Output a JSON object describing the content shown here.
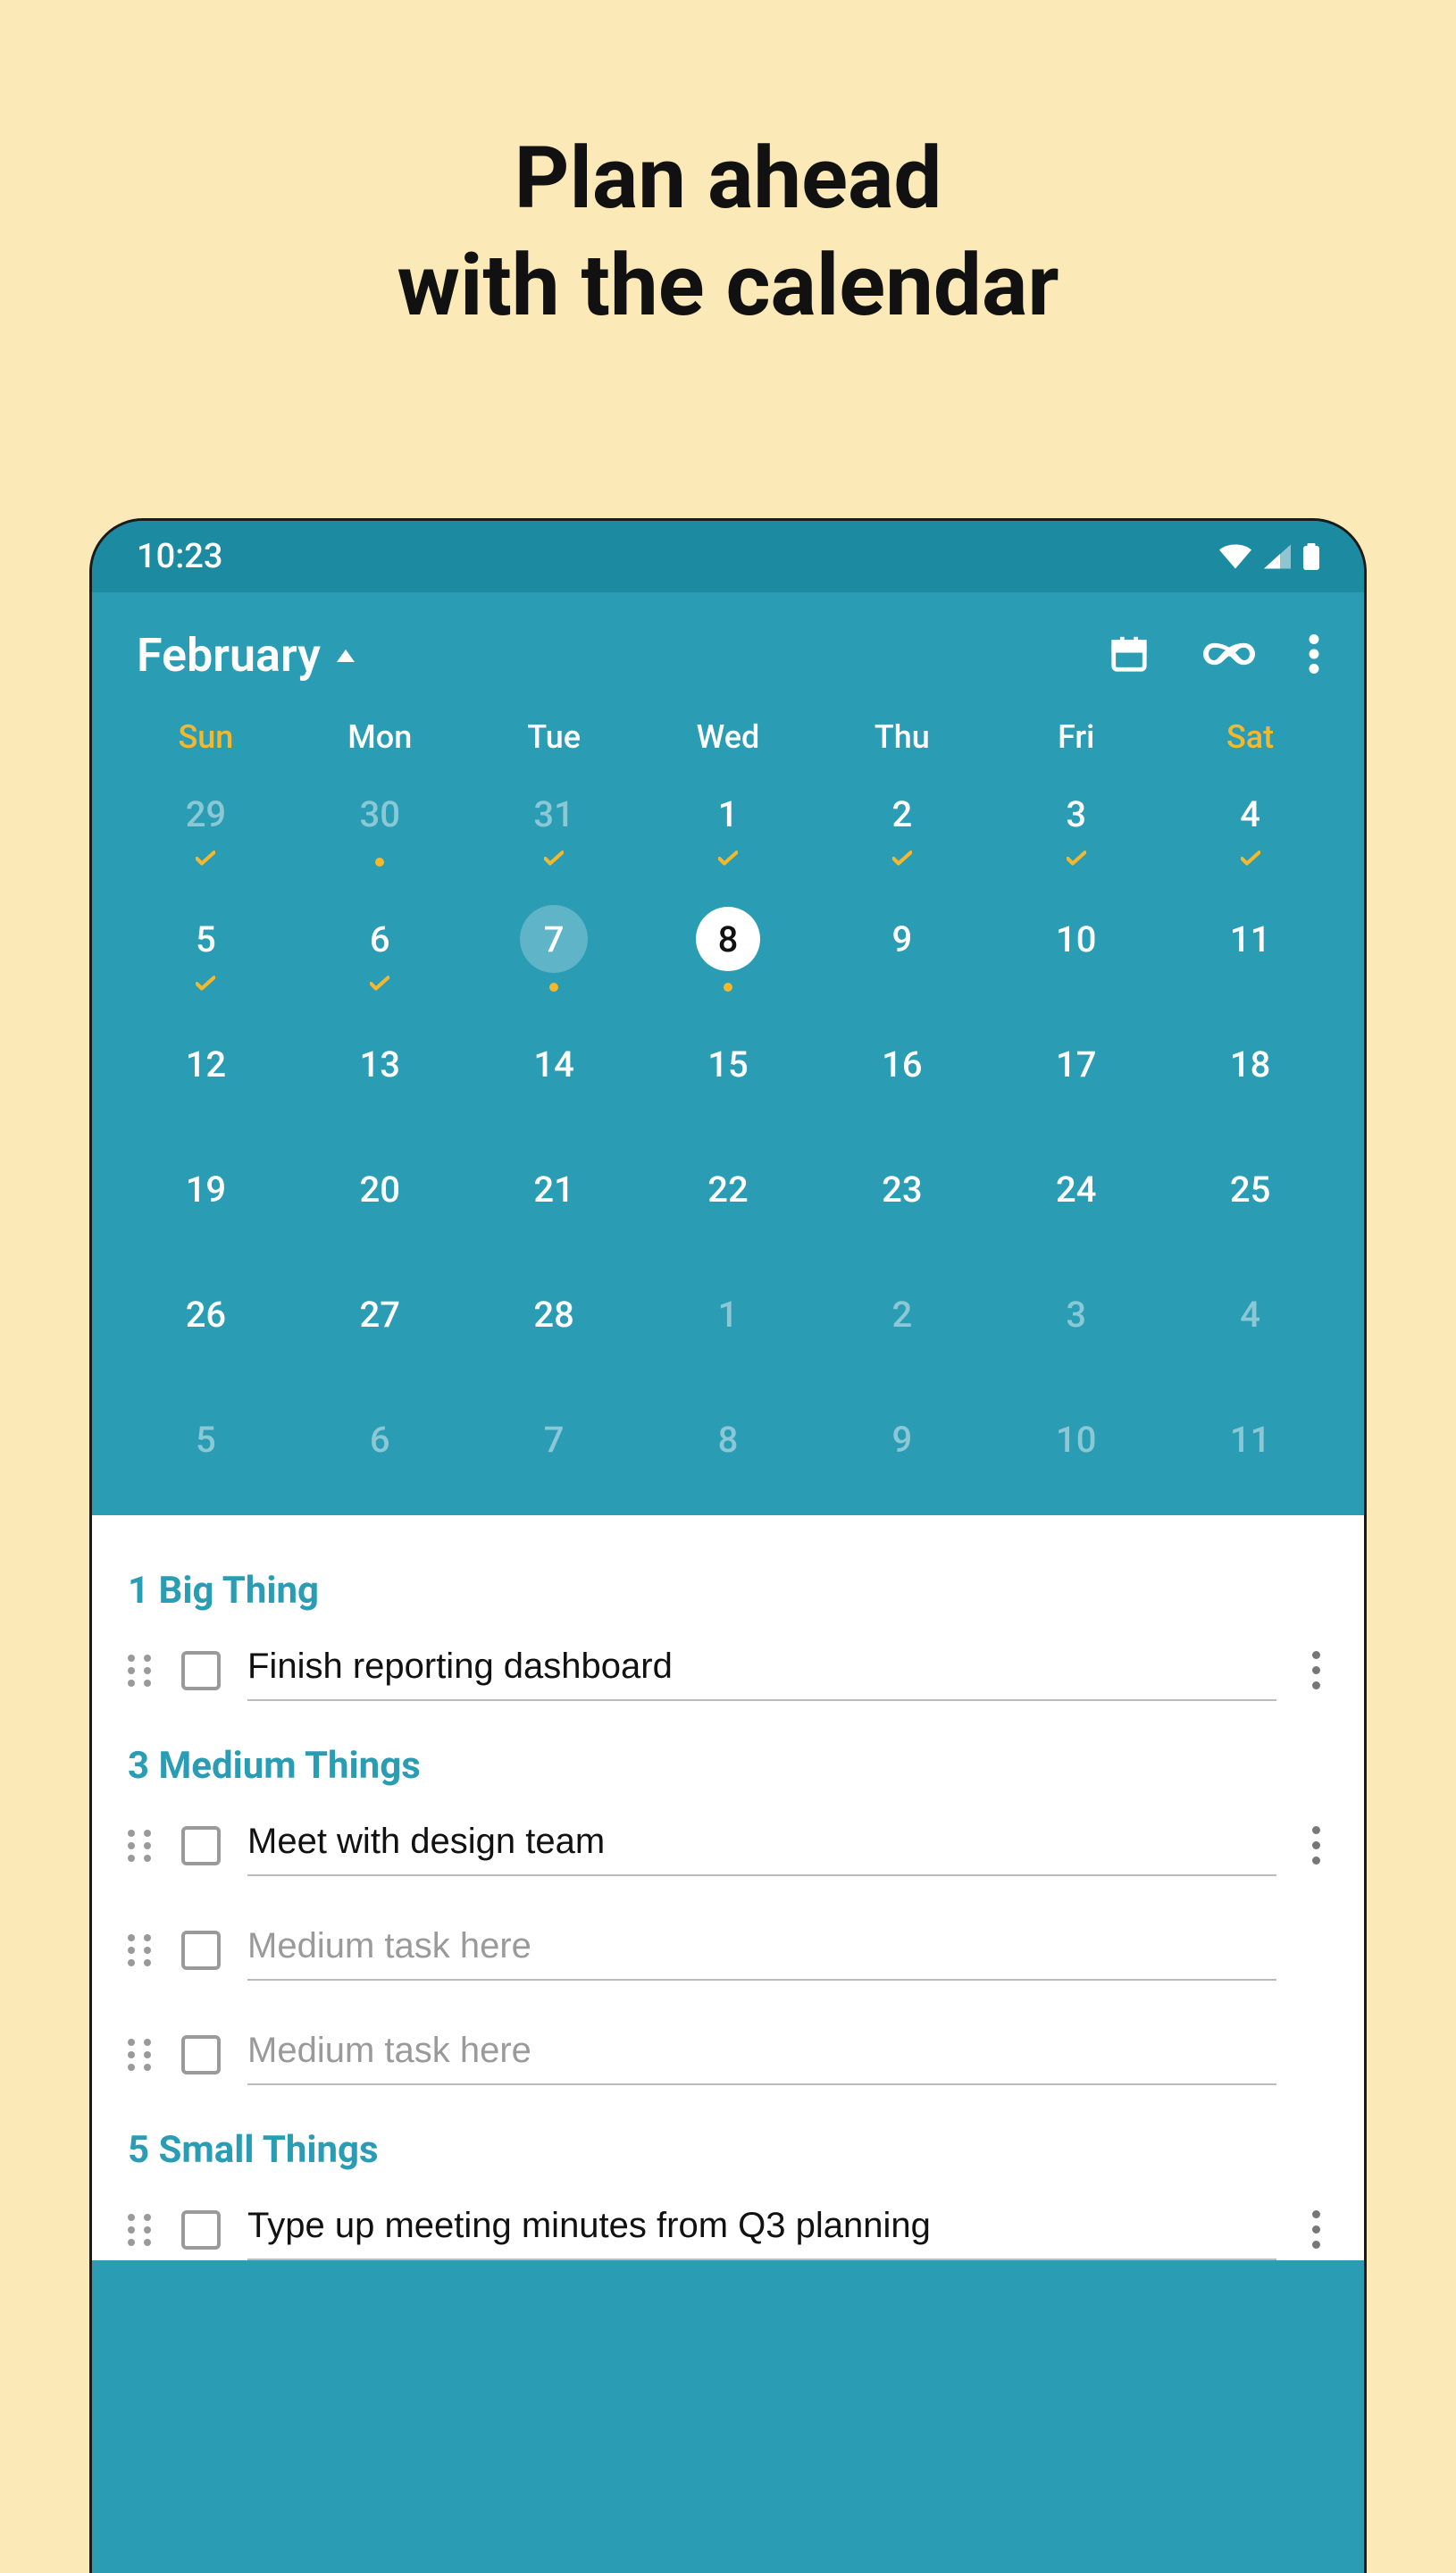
{
  "promo": {
    "line1": "Plan ahead",
    "line2": "with the calendar"
  },
  "status": {
    "time": "10:23"
  },
  "header": {
    "month": "February"
  },
  "weekdays": [
    "Sun",
    "Mon",
    "Tue",
    "Wed",
    "Thu",
    "Fri",
    "Sat"
  ],
  "calendar_rows": [
    [
      {
        "n": "29",
        "faded": true,
        "ind": "check"
      },
      {
        "n": "30",
        "faded": true,
        "ind": "dot"
      },
      {
        "n": "31",
        "faded": true,
        "ind": "check"
      },
      {
        "n": "1",
        "ind": "check"
      },
      {
        "n": "2",
        "ind": "check"
      },
      {
        "n": "3",
        "ind": "check"
      },
      {
        "n": "4",
        "ind": "check"
      }
    ],
    [
      {
        "n": "5",
        "ind": "check"
      },
      {
        "n": "6",
        "ind": "check"
      },
      {
        "n": "7",
        "selected": true,
        "ind": "dot"
      },
      {
        "n": "8",
        "today": true,
        "ind": "dot"
      },
      {
        "n": "9"
      },
      {
        "n": "10"
      },
      {
        "n": "11"
      }
    ],
    [
      {
        "n": "12"
      },
      {
        "n": "13"
      },
      {
        "n": "14"
      },
      {
        "n": "15"
      },
      {
        "n": "16"
      },
      {
        "n": "17"
      },
      {
        "n": "18"
      }
    ],
    [
      {
        "n": "19"
      },
      {
        "n": "20"
      },
      {
        "n": "21"
      },
      {
        "n": "22"
      },
      {
        "n": "23"
      },
      {
        "n": "24"
      },
      {
        "n": "25"
      }
    ],
    [
      {
        "n": "26"
      },
      {
        "n": "27"
      },
      {
        "n": "28"
      },
      {
        "n": "1",
        "faded": true
      },
      {
        "n": "2",
        "faded": true
      },
      {
        "n": "3",
        "faded": true
      },
      {
        "n": "4",
        "faded": true
      }
    ],
    [
      {
        "n": "5",
        "faded": true
      },
      {
        "n": "6",
        "faded": true
      },
      {
        "n": "7",
        "faded": true
      },
      {
        "n": "8",
        "faded": true
      },
      {
        "n": "9",
        "faded": true
      },
      {
        "n": "10",
        "faded": true
      },
      {
        "n": "11",
        "faded": true
      }
    ]
  ],
  "sections": {
    "big": {
      "title": "1 Big Thing",
      "tasks": [
        {
          "value": "Finish reporting dashboard",
          "placeholder": "",
          "menu": true
        }
      ]
    },
    "medium": {
      "title": "3 Medium Things",
      "tasks": [
        {
          "value": "Meet with design team",
          "placeholder": "",
          "menu": true
        },
        {
          "value": "",
          "placeholder": "Medium task here",
          "menu": false
        },
        {
          "value": "",
          "placeholder": "Medium task here",
          "menu": false
        }
      ]
    },
    "small": {
      "title": "5 Small Things",
      "tasks": [
        {
          "value": "Type up meeting minutes from Q3 planning",
          "placeholder": "",
          "menu": true
        }
      ]
    }
  }
}
